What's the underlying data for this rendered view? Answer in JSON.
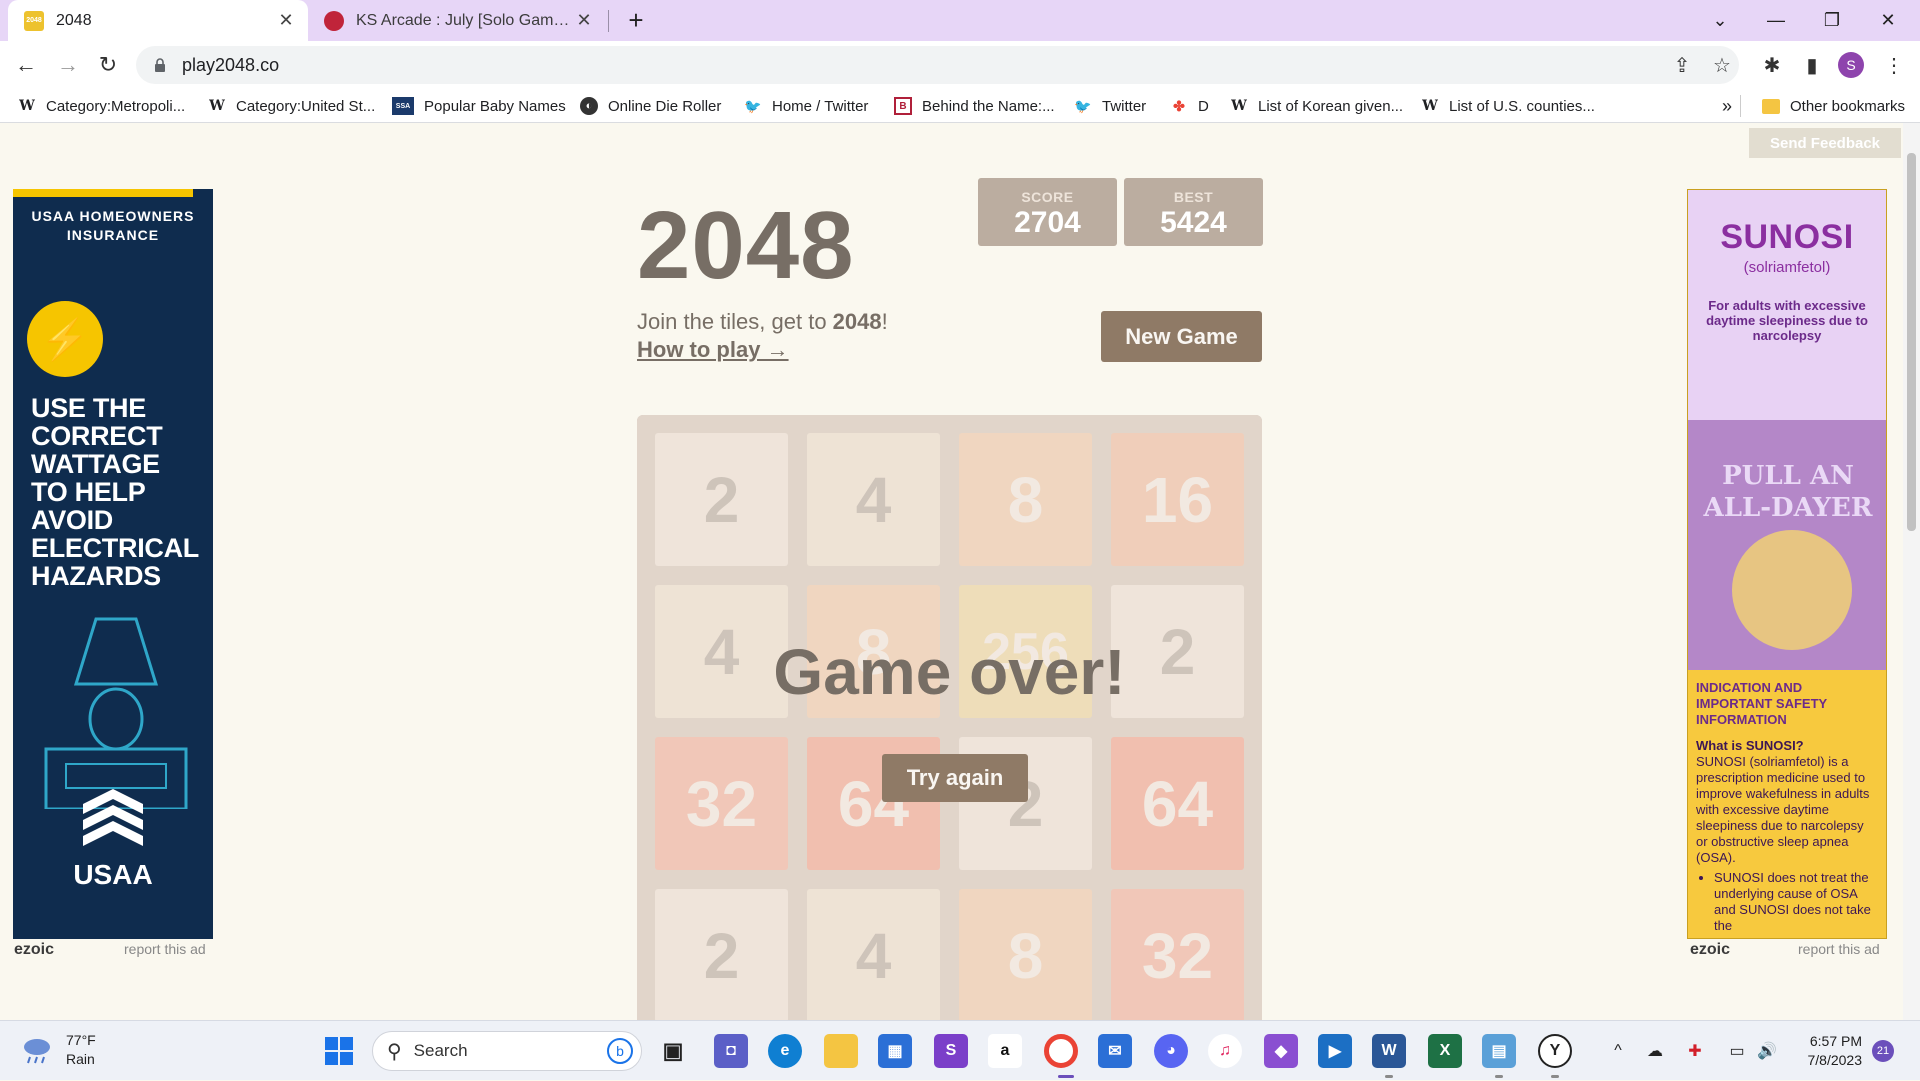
{
  "browser": {
    "tabs": [
      {
        "title": "2048",
        "active": true,
        "favicon": "2048-favicon",
        "favicon_text": "2048"
      },
      {
        "title": "KS Arcade : July [Solo Games] - K",
        "active": false,
        "favicon": "ks-arcade-favicon"
      }
    ],
    "new_tab": "+",
    "url": "play2048.co",
    "profile_initial": "S",
    "bookmarks": [
      {
        "label": "Category:Metropoli...",
        "icon": "W"
      },
      {
        "label": "Category:United St...",
        "icon": "W"
      },
      {
        "label": "Popular Baby Names",
        "icon": "SSA"
      },
      {
        "label": "Online Die Roller",
        "icon": "globe"
      },
      {
        "label": "Home / Twitter",
        "icon": "twitter"
      },
      {
        "label": "Behind the Name:...",
        "icon": "behind-the-name"
      },
      {
        "label": "Twitter",
        "icon": "twitter"
      },
      {
        "label": "D",
        "icon": "pinwheel"
      },
      {
        "label": "List of Korean given...",
        "icon": "W"
      },
      {
        "label": "List of U.S. counties...",
        "icon": "W"
      }
    ],
    "bookmarks_overflow": "»",
    "other_bookmarks": "Other bookmarks"
  },
  "game": {
    "feedback_label": "Send Feedback",
    "title": "2048",
    "score_label": "SCORE",
    "score": "2704",
    "best_label": "BEST",
    "best": "5424",
    "intro_text": "Join the tiles, get to ",
    "intro_goal": "2048",
    "intro_end": "!",
    "how_to_play": "How to play →",
    "new_game_label": "New Game",
    "board": [
      [
        "2",
        "4",
        "8",
        "16"
      ],
      [
        "4",
        "8",
        "256",
        "2"
      ],
      [
        "32",
        "64",
        "2",
        "64"
      ],
      [
        "2",
        "4",
        "8",
        "32"
      ]
    ],
    "game_over_text": "Game over!",
    "try_again_label": "Try again",
    "colors": {
      "background": "#faf8ef",
      "board": "#bbada0",
      "text_dark": "#776e65",
      "button": "#8f7a66"
    }
  },
  "ads": {
    "left": {
      "brand_line": "USAA HOMEOWNERS INSURANCE",
      "headline": "USE THE CORRECT WATTAGE TO HELP AVOID ELECTRICAL HAZARDS",
      "logo": "USAA"
    },
    "right": {
      "brand": "SUNOSI",
      "sub": "(solriamfetol)",
      "tagline": "For adults with excessive daytime sleepiness due to narcolepsy",
      "photo_text": "PULL AN ALL-DAYER",
      "info_heading": "INDICATION AND IMPORTANT SAFETY INFORMATION",
      "info_question": "What is SUNOSI?",
      "info_body": "SUNOSI (solriamfetol) is a prescription medicine used to improve wakefulness in adults with excessive daytime sleepiness due to narcolepsy or obstructive sleep apnea (OSA).",
      "info_bullet": "SUNOSI does not treat the underlying cause of OSA and SUNOSI does not take the"
    },
    "ezoic_label": "ezoic",
    "report_label": "report this ad"
  },
  "taskbar": {
    "temperature": "77°F",
    "condition": "Rain",
    "search_label": "Search",
    "time": "6:57 PM",
    "date": "7/8/2023",
    "notification_count": "21"
  }
}
